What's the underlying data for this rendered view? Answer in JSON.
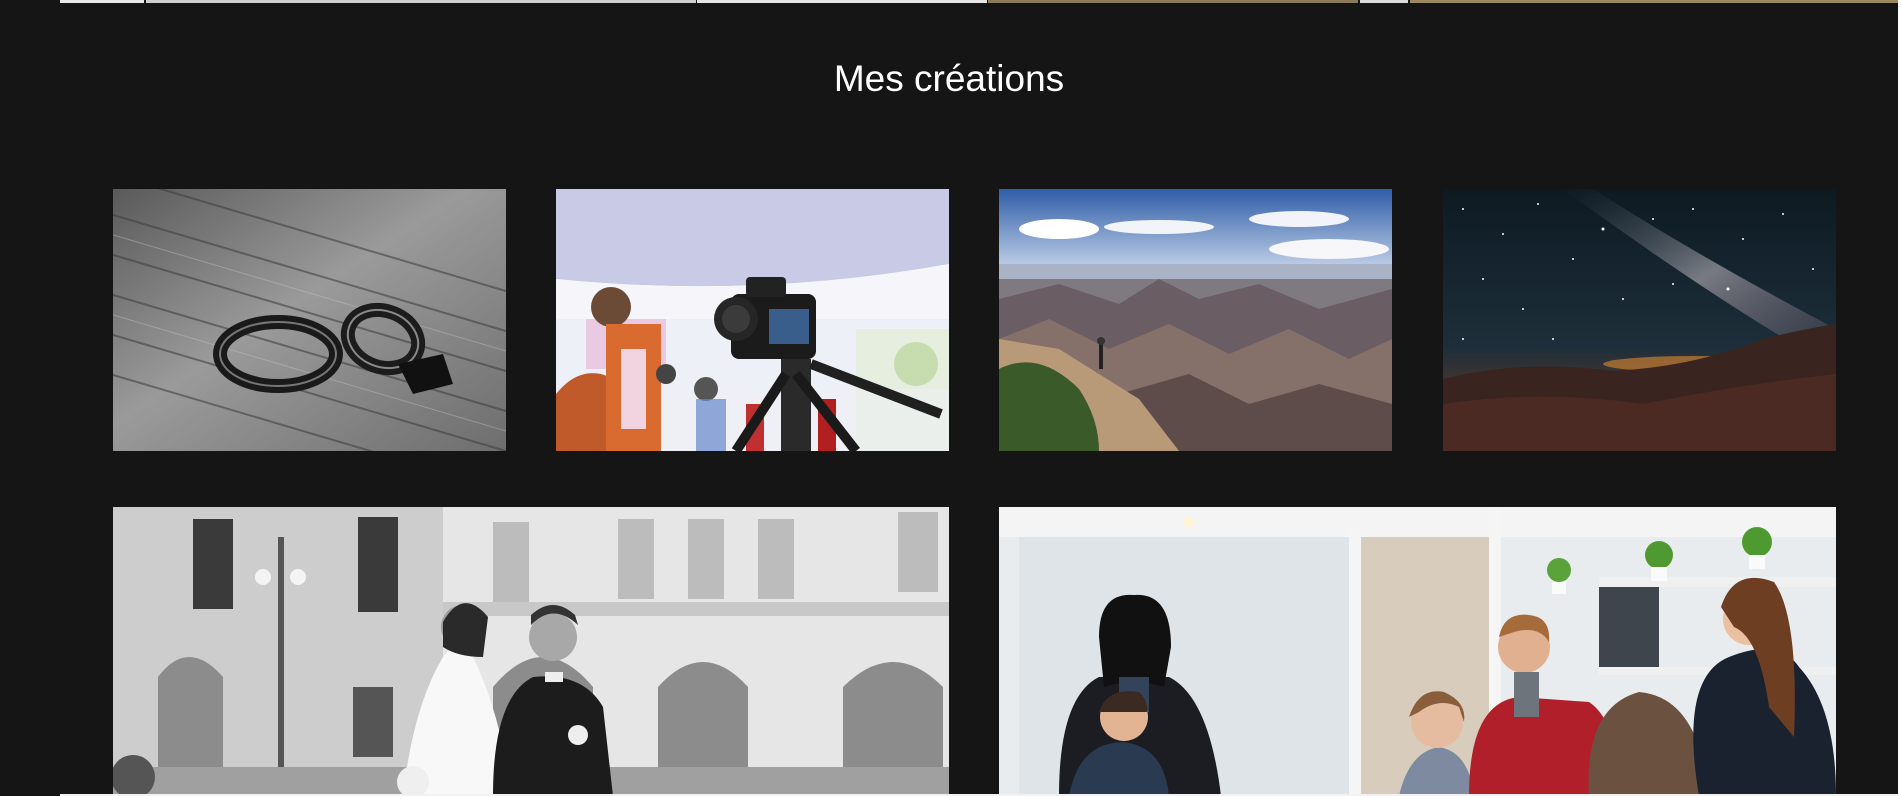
{
  "section": {
    "title": "Mes créations"
  },
  "gallery": {
    "items": [
      {
        "subject": "wedding-rings"
      },
      {
        "subject": "camera-event"
      },
      {
        "subject": "canyon-landscape"
      },
      {
        "subject": "milky-way-night"
      },
      {
        "subject": "wedding-couple"
      },
      {
        "subject": "office-meeting"
      }
    ]
  },
  "colors": {
    "background": "#151515",
    "title": "#ffffff"
  }
}
